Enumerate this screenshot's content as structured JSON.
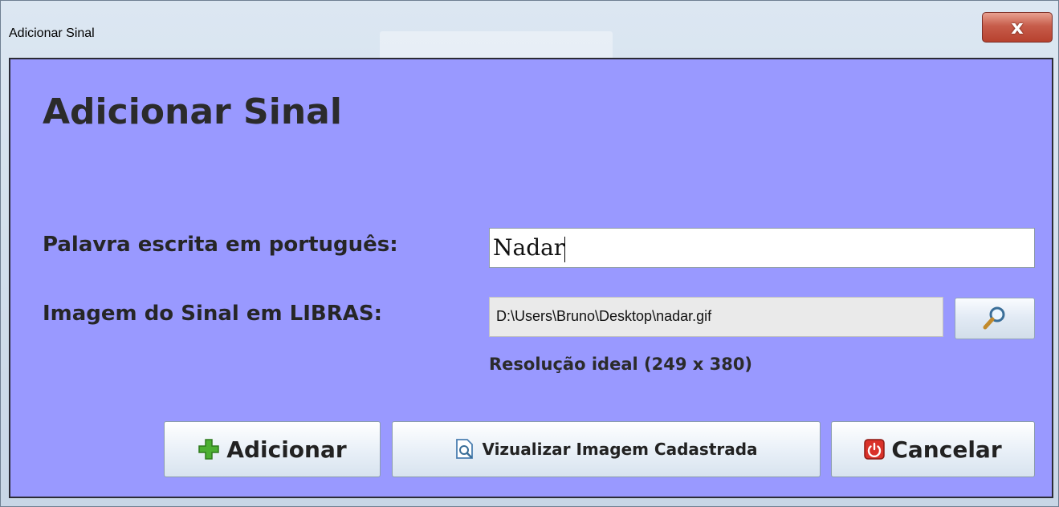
{
  "window": {
    "title": "Adicionar Sinal",
    "close_label": "x"
  },
  "form": {
    "heading": "Adicionar Sinal",
    "word_label": "Palavra escrita em português:",
    "word_value": "Nadar",
    "image_label": "Imagem do Sinal em LIBRAS:",
    "image_path": "D:\\Users\\Bruno\\Desktop\\nadar.gif",
    "resolution_hint": "Resolução ideal (249 x 380)"
  },
  "buttons": {
    "add_label": "Adicionar",
    "view_label": "Vizualizar Imagem Cadastrada",
    "cancel_label": "Cancelar"
  },
  "icons": {
    "add": "plus-icon",
    "view": "magnify-page-icon",
    "cancel": "power-icon",
    "browse": "magnifier-icon"
  },
  "colors": {
    "client_background": "#9999ff",
    "close_button": "#c75d4b",
    "plus": "#4caf32",
    "power": "#d9322a"
  }
}
